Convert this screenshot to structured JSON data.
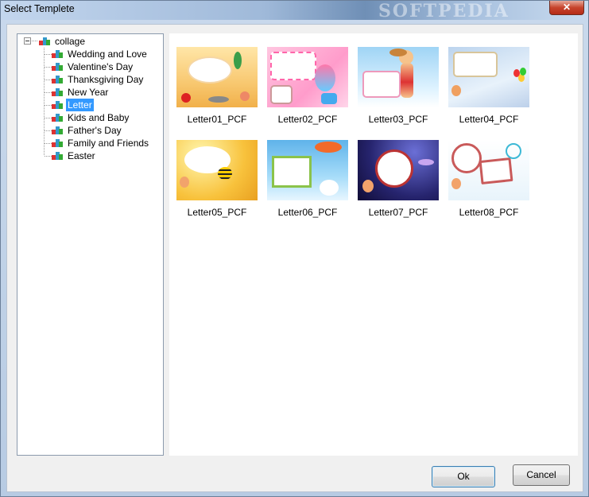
{
  "window": {
    "title": "Select Templete",
    "watermark": "SOFTPEDIA",
    "close_glyph": "✕"
  },
  "tree": {
    "root": {
      "label": "collage",
      "icon": "collage-tree-icon"
    },
    "items": [
      {
        "label": "Wedding and Love",
        "selected": false
      },
      {
        "label": "Valentine's Day",
        "selected": false
      },
      {
        "label": "Thanksgiving Day",
        "selected": false
      },
      {
        "label": "New Year",
        "selected": false
      },
      {
        "label": "Letter",
        "selected": true
      },
      {
        "label": "Kids and Baby",
        "selected": false
      },
      {
        "label": "Father's Day",
        "selected": false
      },
      {
        "label": "Family and Friends",
        "selected": false
      },
      {
        "label": "Easter",
        "selected": false
      }
    ]
  },
  "gallery": {
    "templates": [
      {
        "label": "Letter01_PCF"
      },
      {
        "label": "Letter02_PCF"
      },
      {
        "label": "Letter03_PCF"
      },
      {
        "label": "Letter04_PCF"
      },
      {
        "label": "Letter05_PCF"
      },
      {
        "label": "Letter06_PCF"
      },
      {
        "label": "Letter07_PCF"
      },
      {
        "label": "Letter08_PCF"
      }
    ]
  },
  "buttons": {
    "ok": "Ok",
    "cancel": "Cancel"
  },
  "colors": {
    "selection": "#3399ff",
    "titlebar": "#9fb9d9",
    "close": "#c7442d"
  }
}
